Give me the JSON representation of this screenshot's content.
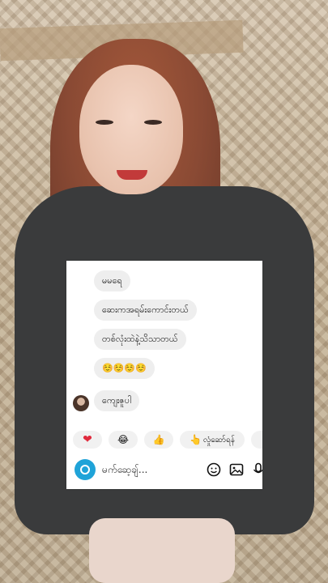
{
  "chat": {
    "messages": [
      {
        "text": "မမရေ"
      },
      {
        "text": "ဆေးကအရမ်းကောင်းတယ်"
      },
      {
        "text": "တစ်လုံးထဲနဲ့သိသာတယ်"
      },
      {
        "text": "☺️☺️☺️☺️"
      },
      {
        "text": "ကျေးဇူပါ"
      }
    ],
    "reactions": [
      {
        "icon": "heart-icon",
        "glyph": "❤"
      },
      {
        "icon": "laughing-emoji-icon",
        "glyph": "😂"
      },
      {
        "icon": "thumbs-up-icon",
        "glyph": "👍"
      },
      {
        "icon": "pointing-hand-icon",
        "glyph": "👆",
        "label": "လှုံဆော်ရန်"
      }
    ],
    "input": {
      "placeholder": "မက်ဆေ့ချ်..."
    },
    "colors": {
      "bubble": "#eeeeee",
      "camera_button": "#1fa3d8",
      "card": "#ffffff"
    }
  }
}
